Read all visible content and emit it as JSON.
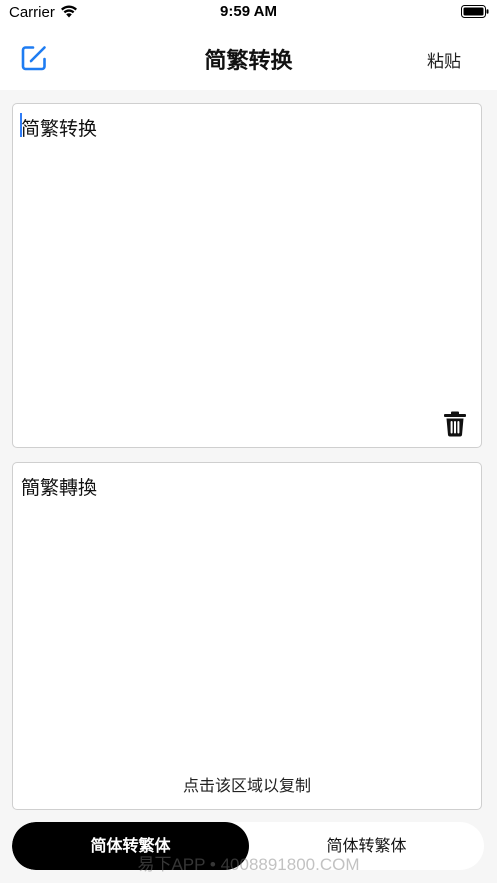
{
  "status_bar": {
    "carrier": "Carrier",
    "time": "9:59 AM",
    "icons": [
      "wifi-icon",
      "battery-icon"
    ]
  },
  "nav_bar": {
    "title": "简繁转换",
    "left_icon": "edit-icon",
    "right_label": "粘贴"
  },
  "input": {
    "text": "简繁转换",
    "clear_icon": "trash-icon"
  },
  "output": {
    "text": "簡繁轉換",
    "hint": "点击该区域以复制"
  },
  "mode_switch": {
    "options": [
      "简体转繁体",
      "简体转繁体"
    ],
    "selected_index": 0
  },
  "watermark": "易下APP • 4008891800.COM",
  "colors": {
    "accent": "#2f7cf6",
    "selected_segment": "#000000",
    "background": "#f6f6f6"
  }
}
